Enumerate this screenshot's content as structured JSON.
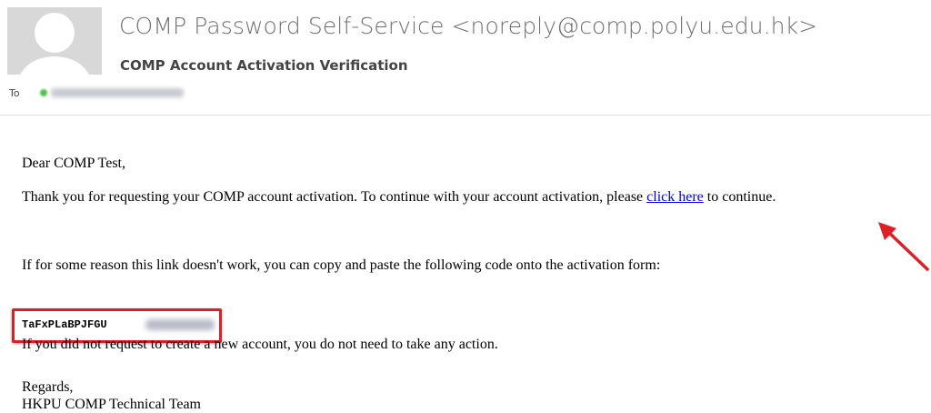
{
  "email": {
    "sender": "COMP Password Self-Service <noreply@comp.polyu.edu.hk>",
    "subject": "COMP Account Activation Verification",
    "to_label": "To",
    "recipient_status_color": "#4cc04c"
  },
  "message": {
    "greeting": "Dear COMP Test,",
    "para1_before_link": "Thank you for requesting your COMP account activation. To continue with your account activation, please ",
    "link_text": "click here",
    "para1_after_link": " to continue.",
    "para2": "If for some reason this link doesn't work, you can copy and paste the following code onto the activation form:",
    "code_visible": "TaFxPLaBPJFGU",
    "para3": "If you did not request to create a new account, you do not need to take any action.",
    "sign_off": "Regards,",
    "signature": "HKPU  COMP Technical Team"
  },
  "annotations": {
    "highlight_color": "#dd1f26",
    "arrow_color": "#dd1f26"
  }
}
